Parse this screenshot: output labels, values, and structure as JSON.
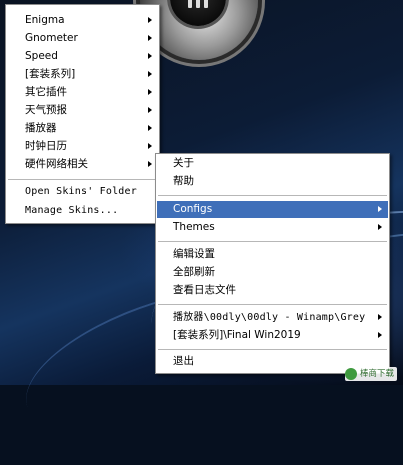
{
  "menu_main": {
    "items": [
      {
        "label": "Enigma",
        "has_submenu": true
      },
      {
        "label": "Gnometer",
        "has_submenu": true
      },
      {
        "label": "Speed",
        "has_submenu": true
      },
      {
        "label": "[套装系列]",
        "has_submenu": true
      },
      {
        "label": "其它插件",
        "has_submenu": true
      },
      {
        "label": "天气预报",
        "has_submenu": true
      },
      {
        "label": "播放器",
        "has_submenu": true
      },
      {
        "label": "时钟日历",
        "has_submenu": true
      },
      {
        "label": "硬件网络相关",
        "has_submenu": true
      }
    ],
    "actions": [
      {
        "label": "Open Skins' Folder"
      },
      {
        "label": "Manage Skins..."
      }
    ]
  },
  "menu_sub": {
    "items": [
      {
        "label": "关于",
        "has_submenu": false
      },
      {
        "label": "帮助",
        "has_submenu": false
      },
      {
        "label": "Configs",
        "has_submenu": true,
        "highlighted": true
      },
      {
        "label": "Themes",
        "has_submenu": true
      },
      {
        "label": "编辑设置",
        "has_submenu": false
      },
      {
        "label": "全部刷新",
        "has_submenu": false
      },
      {
        "label": "查看日志文件",
        "has_submenu": false
      },
      {
        "label": "播放器\\00dly\\00dly - Winamp\\Grey",
        "has_submenu": true
      },
      {
        "label": "[套装系列]\\Final Win2019",
        "has_submenu": true
      },
      {
        "label": "退出",
        "has_submenu": false
      }
    ]
  },
  "watermark": {
    "text": "棒商下载"
  },
  "colors": {
    "menu_background": "#ffffff",
    "highlight": "#3f6fb9",
    "highlight_text": "#ffffff",
    "separator": "#b7b7b7",
    "desktop": "#0c1c36"
  }
}
